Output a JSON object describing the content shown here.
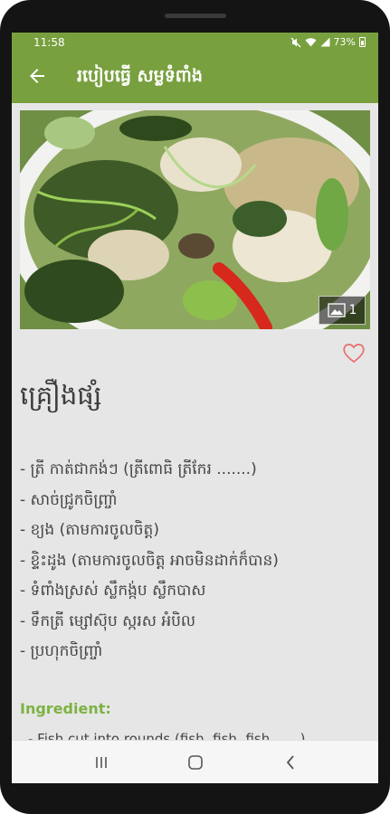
{
  "status_bar": {
    "time": "11:58",
    "battery_text": "73%",
    "icons": [
      "mute-icon",
      "wifi-icon",
      "signal-icon",
      "battery-icon"
    ]
  },
  "app_bar": {
    "title": "របៀបធ្វើ សម្លទំពាំង",
    "back_icon": "arrow-left-icon",
    "background": "#78a03e"
  },
  "photo": {
    "description_icon": "image-icon",
    "count": "1"
  },
  "favorite": {
    "icon": "heart-outline-icon",
    "color": "#e57373"
  },
  "ingredients_section": {
    "title": "គ្រឿងផ្សំ",
    "items": [
      "- ត្រី កាត់ជាកង់ៗ (ត្រីពោធិ ត្រីកែរ .......)",
      "- សាច់ជ្រូកចិញ្ច្រាំ",
      "- ខ្យង (តាមការចូលចិត្ត)",
      "- ខ្ទិះដូង (តាមការចូលចិត្ត អាចមិនដាក់ក៏បាន)",
      "- ទំពាំងស្រស់ ស្លឹកង្ក់ប ស្លឹកបាស",
      "- ទឹកត្រី ម្សៅស៊ុប ស្ករស អំបិល",
      "- ប្រហុកចិញ្ច្រាំ"
    ]
  },
  "english_section": {
    "heading": "Ingredient:",
    "first_line": "- Fish cut into rounds (fish, fish, fish ......)",
    "accent": "#7cb342"
  },
  "nav_bar": {
    "recents_icon": "recents-icon",
    "home_icon": "home-icon",
    "back_icon": "back-chevron-icon"
  }
}
